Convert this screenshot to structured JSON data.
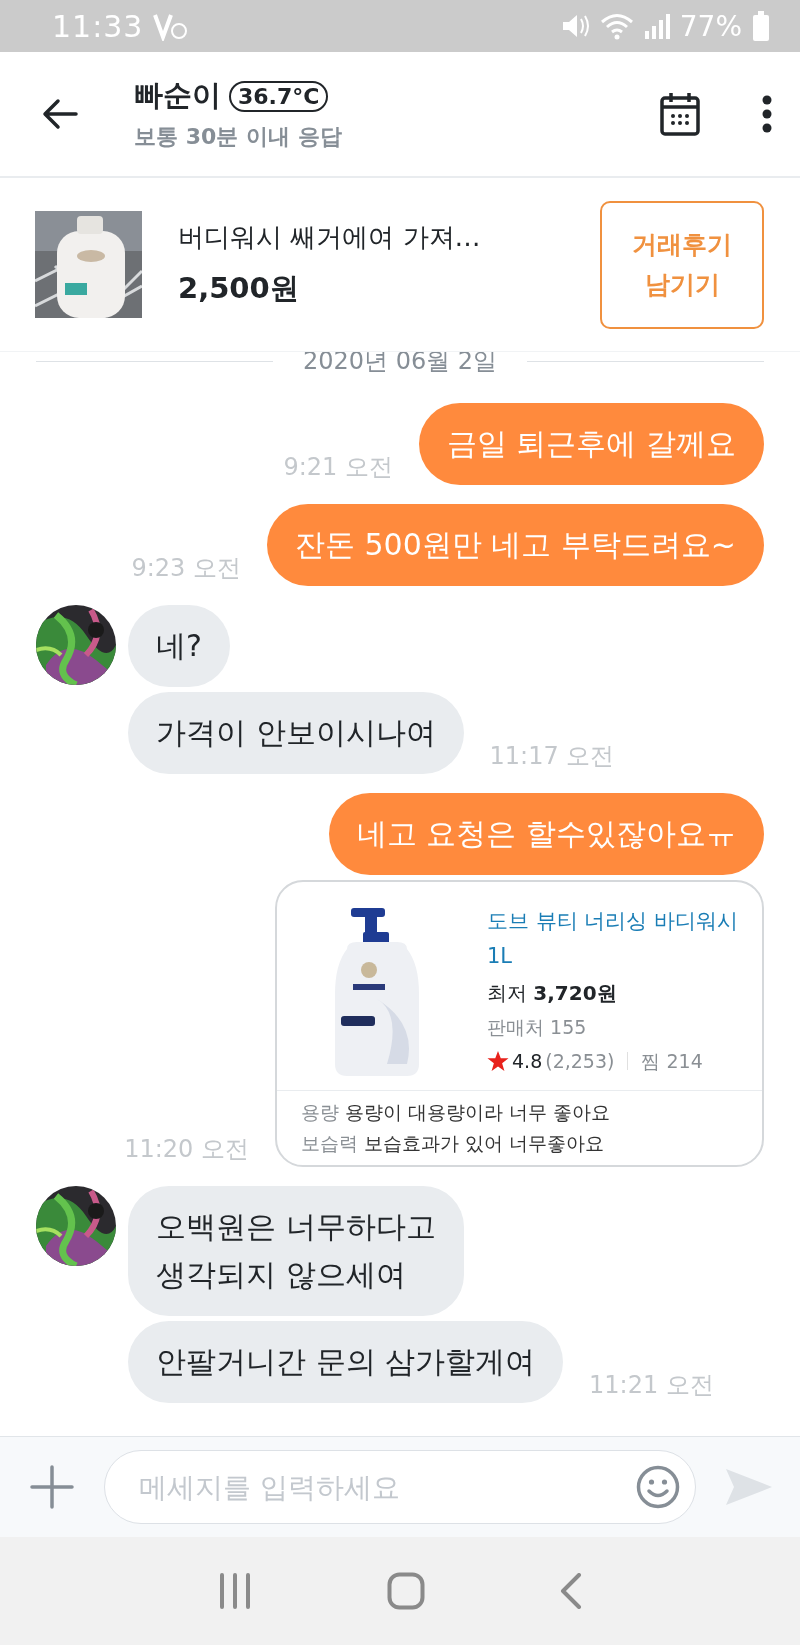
{
  "status_bar": {
    "time": "11:33",
    "battery": "77%"
  },
  "header": {
    "name": "빠순이",
    "temperature": "36.7°C",
    "subtitle": "보통 30분 이내 응답"
  },
  "product": {
    "title": "버디워시 쌔거에여 가져…",
    "price": "2,500원",
    "button": "거래후기 남기기"
  },
  "date_divider": "2020년 06월 2일",
  "messages": [
    {
      "kind": "outgoing",
      "text": "금일 퇴근후에 갈께요",
      "time": "9:21 오전"
    },
    {
      "kind": "outgoing",
      "text": "잔돈 500원만 네고 부탁드려요~",
      "time": "9:23 오전"
    },
    {
      "kind": "incoming",
      "avatar": true,
      "text": "네?"
    },
    {
      "kind": "incoming",
      "avatar": false,
      "text": "가격이 안보이시나여",
      "time": "11:17 오전"
    },
    {
      "kind": "outgoing",
      "text": "네고 요청은 할수있잖아요ㅠ"
    },
    {
      "kind": "link_card",
      "title": "도브 뷰티 너리싱 바디워시 1L",
      "price": "최저 **3,720원**",
      "sellers": "판매처 155",
      "rating": "4.8",
      "reviews": "(2,253)",
      "wishes": "찜 214",
      "specs": [
        {
          "label": "용량",
          "text": "용량이 대용량이라 너무 좋아요"
        },
        {
          "label": "보습력",
          "text": "보습효과가 있어 너무좋아요"
        }
      ],
      "time": "11:20 오전"
    },
    {
      "kind": "incoming",
      "avatar": true,
      "text": "오백원은 너무하다고\n생각되지 않으세여"
    },
    {
      "kind": "incoming",
      "avatar": false,
      "text": "안팔거니간 문의 삼가할게여",
      "time": "11:21 오전"
    }
  ],
  "input": {
    "placeholder": "메세지를 입력하세요"
  }
}
